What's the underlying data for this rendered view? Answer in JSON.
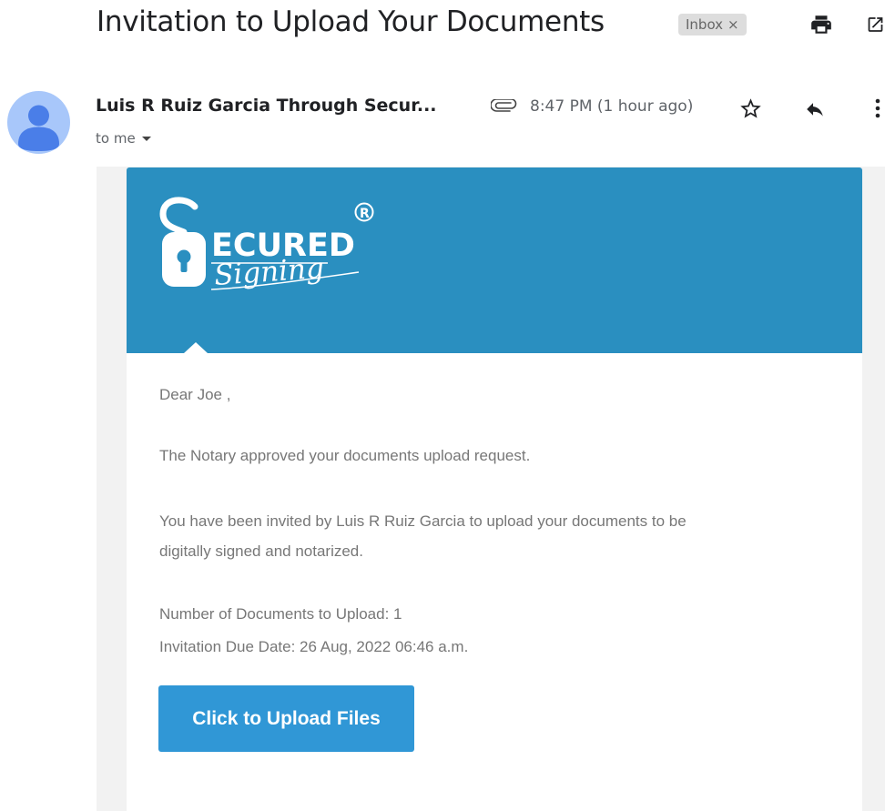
{
  "email": {
    "subject": "Invitation to Upload Your Documents",
    "label": "Inbox",
    "label_remove": "×",
    "sender": "Luis R Ruiz Garcia Through Secur...",
    "recipient": "to me",
    "time": "8:47 PM (1 hour ago)"
  },
  "icons": {
    "print": "print-icon",
    "open_new_window": "open-in-new-window-icon",
    "attachment": "paperclip-icon",
    "star": "star-icon",
    "reply": "reply-icon",
    "more": "more-vert-icon",
    "avatar": "person-avatar-icon"
  },
  "banner": {
    "brand_word": "ECURED",
    "brand_script": "Signing",
    "brand_mark": "R",
    "color": "#2a8fc0"
  },
  "content": {
    "greeting": "Dear Joe ,",
    "line1": "The Notary approved your documents upload request.",
    "line2a": "You have been invited by Luis R Ruiz Garcia to upload your documents to be",
    "line2b": "digitally signed and notarized.",
    "doc_count": "Number of Documents to Upload: 1",
    "due_date": "Invitation Due Date: 26 Aug, 2022 06:46 a.m."
  },
  "button": {
    "label": "Click to Upload Files",
    "color": "#3097d6"
  }
}
